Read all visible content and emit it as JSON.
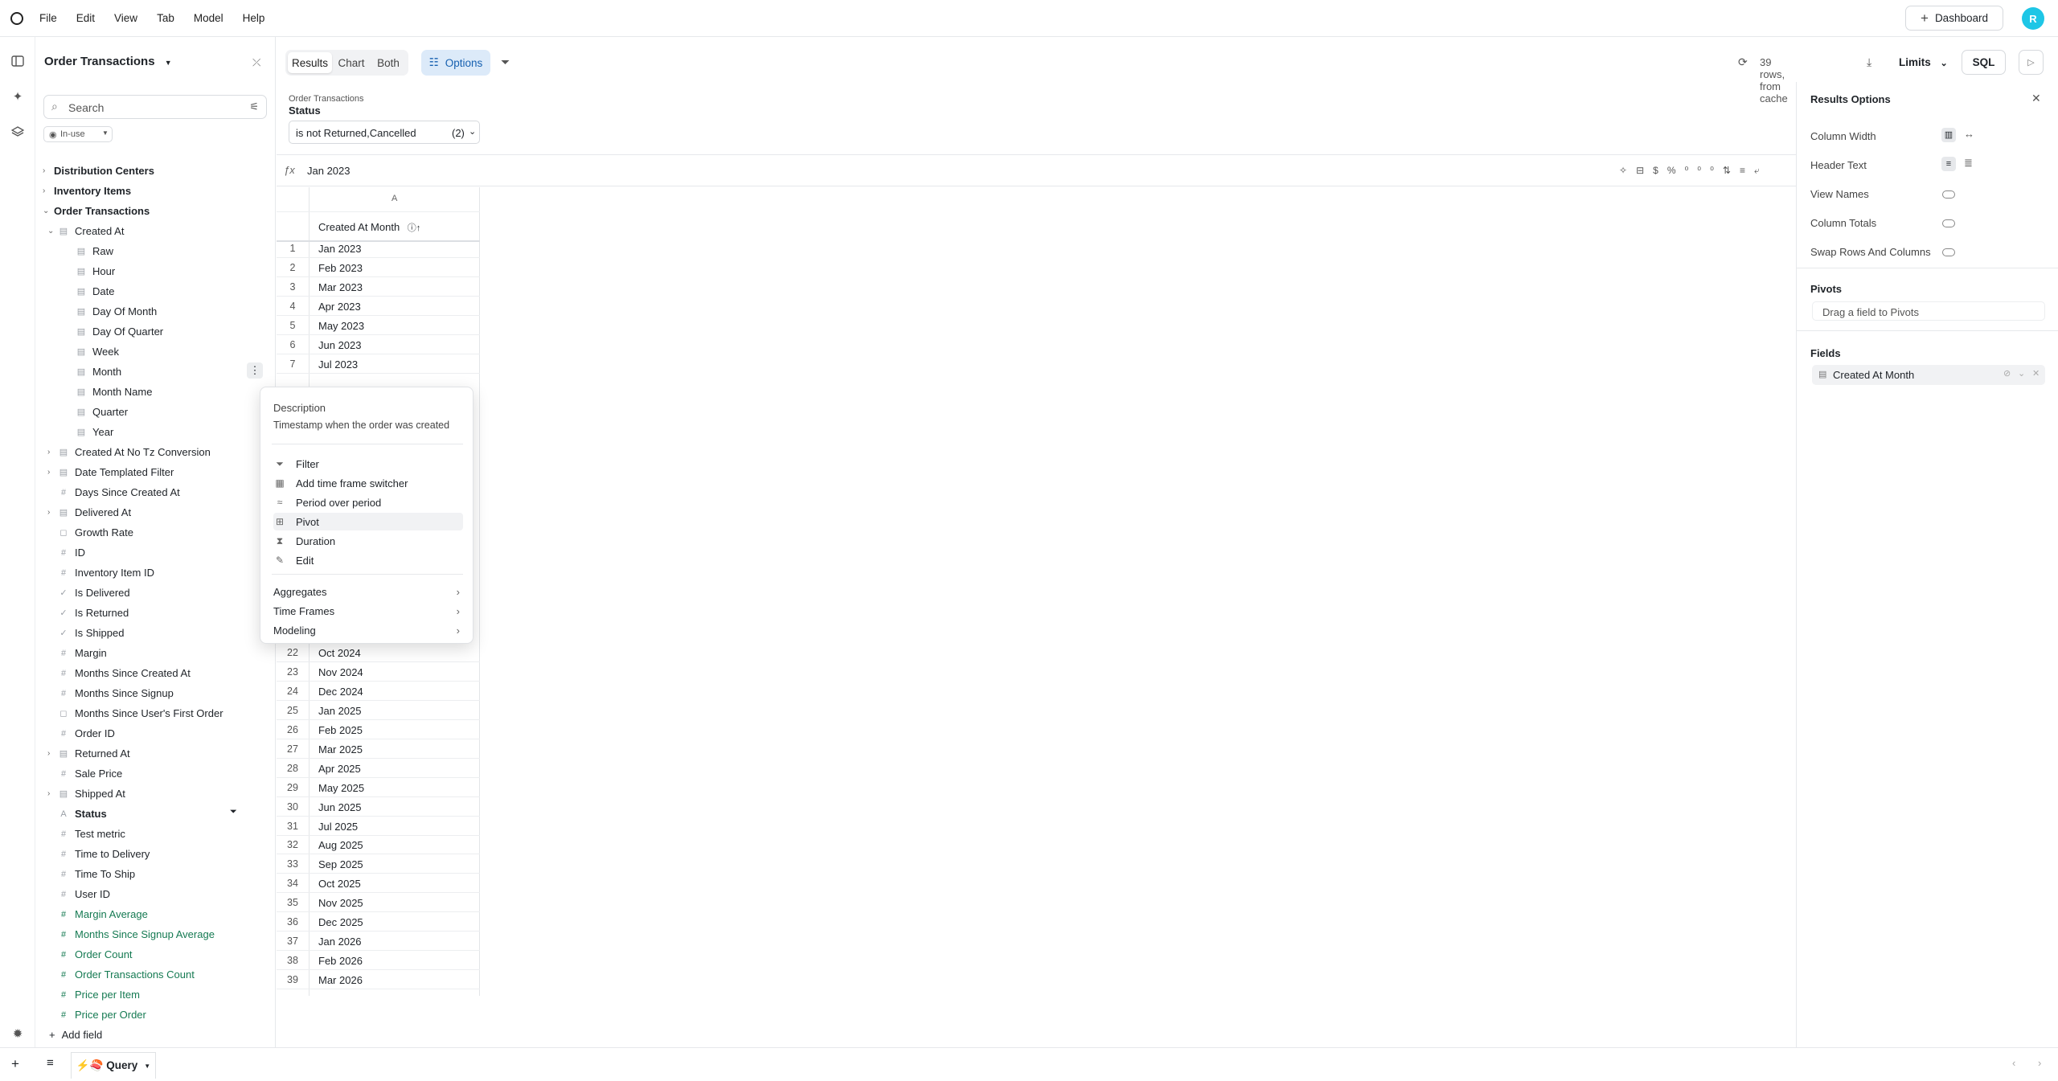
{
  "menubar": {
    "items": [
      "File",
      "Edit",
      "View",
      "Tab",
      "Model",
      "Help"
    ],
    "dashboard_label": "Dashboard",
    "avatar_letter": "R"
  },
  "sidebar": {
    "title": "Order Transactions",
    "search_placeholder": "Search",
    "inuse_label": "In-use",
    "add_field_label": "Add field",
    "rows": [
      {
        "label": "Distribution Centers",
        "level": 0,
        "chev": "›",
        "bold": true
      },
      {
        "label": "Inventory Items",
        "level": 0,
        "chev": "›",
        "bold": true
      },
      {
        "label": "Order Transactions",
        "level": 0,
        "chev": "⌄",
        "bold": true
      },
      {
        "label": "Created At",
        "level": 1,
        "chev": "⌄",
        "icon": "▤"
      },
      {
        "label": "Raw",
        "level": 2,
        "icon": "▤"
      },
      {
        "label": "Hour",
        "level": 2,
        "icon": "▤"
      },
      {
        "label": "Date",
        "level": 2,
        "icon": "▤"
      },
      {
        "label": "Day Of Month",
        "level": 2,
        "icon": "▤"
      },
      {
        "label": "Day Of Quarter",
        "level": 2,
        "icon": "▤"
      },
      {
        "label": "Week",
        "level": 2,
        "icon": "▤"
      },
      {
        "label": "Month",
        "level": 2,
        "icon": "▤",
        "menu": true
      },
      {
        "label": "Month Name",
        "level": 2,
        "icon": "▤"
      },
      {
        "label": "Quarter",
        "level": 2,
        "icon": "▤"
      },
      {
        "label": "Year",
        "level": 2,
        "icon": "▤"
      },
      {
        "label": "Created At No Tz Conversion",
        "level": 1,
        "chev": "›",
        "icon": "▤"
      },
      {
        "label": "Date Templated Filter",
        "level": 1,
        "chev": "›",
        "icon": "▤"
      },
      {
        "label": "Days Since Created At",
        "level": 1,
        "icon": "#"
      },
      {
        "label": "Delivered At",
        "level": 1,
        "chev": "›",
        "icon": "▤"
      },
      {
        "label": "Growth Rate",
        "level": 1,
        "icon": "◻"
      },
      {
        "label": "ID",
        "level": 1,
        "icon": "#"
      },
      {
        "label": "Inventory Item ID",
        "level": 1,
        "icon": "#"
      },
      {
        "label": "Is Delivered",
        "level": 1,
        "icon": "✓"
      },
      {
        "label": "Is Returned",
        "level": 1,
        "icon": "✓"
      },
      {
        "label": "Is Shipped",
        "level": 1,
        "icon": "✓"
      },
      {
        "label": "Margin",
        "level": 1,
        "icon": "#"
      },
      {
        "label": "Months Since Created At",
        "level": 1,
        "icon": "#"
      },
      {
        "label": "Months Since Signup",
        "level": 1,
        "icon": "#"
      },
      {
        "label": "Months Since User's First Order",
        "level": 1,
        "icon": "◻"
      },
      {
        "label": "Order ID",
        "level": 1,
        "icon": "#"
      },
      {
        "label": "Returned At",
        "level": 1,
        "chev": "›",
        "icon": "▤"
      },
      {
        "label": "Sale Price",
        "level": 1,
        "icon": "#"
      },
      {
        "label": "Shipped At",
        "level": 1,
        "chev": "›",
        "icon": "▤"
      },
      {
        "label": "Status",
        "level": 1,
        "icon": "A",
        "bold": true,
        "filter": true
      },
      {
        "label": "Test metric",
        "level": 1,
        "icon": "#"
      },
      {
        "label": "Time to Delivery",
        "level": 1,
        "icon": "#"
      },
      {
        "label": "Time To Ship",
        "level": 1,
        "icon": "#"
      },
      {
        "label": "User ID",
        "level": 1,
        "icon": "#"
      },
      {
        "label": "Margin Average",
        "level": 1,
        "icon": "#",
        "measure": true
      },
      {
        "label": "Months Since Signup Average",
        "level": 1,
        "icon": "#",
        "measure": true
      },
      {
        "label": "Order Count",
        "level": 1,
        "icon": "#",
        "measure": true
      },
      {
        "label": "Order Transactions Count",
        "level": 1,
        "icon": "#",
        "measure": true
      },
      {
        "label": "Price per Item",
        "level": 1,
        "icon": "#",
        "measure": true
      },
      {
        "label": "Price per Order",
        "level": 1,
        "icon": "#",
        "measure": true
      }
    ]
  },
  "toolbar": {
    "tabs": [
      "Results",
      "Chart",
      "Both"
    ],
    "options_label": "Options",
    "rows_info": "39 rows, from cache",
    "limits_label": "Limits",
    "sql_label": "SQL"
  },
  "filter": {
    "breadcrumb": "Order Transactions",
    "field": "Status",
    "value": "is not Returned,Cancelled",
    "count": "(2)"
  },
  "formula": {
    "value": "Jan  2023"
  },
  "grid": {
    "column_letter": "A",
    "header": "Created At Month",
    "rows": [
      [
        "1",
        "Jan 2023"
      ],
      [
        "2",
        "Feb 2023"
      ],
      [
        "3",
        "Mar 2023"
      ],
      [
        "4",
        "Apr 2023"
      ],
      [
        "5",
        "May 2023"
      ],
      [
        "6",
        "Jun 2023"
      ],
      [
        "7",
        "Jul 2023"
      ],
      [
        "22",
        "Oct 2024"
      ],
      [
        "23",
        "Nov 2024"
      ],
      [
        "24",
        "Dec 2024"
      ],
      [
        "25",
        "Jan 2025"
      ],
      [
        "26",
        "Feb 2025"
      ],
      [
        "27",
        "Mar 2025"
      ],
      [
        "28",
        "Apr 2025"
      ],
      [
        "29",
        "May 2025"
      ],
      [
        "30",
        "Jun 2025"
      ],
      [
        "31",
        "Jul 2025"
      ],
      [
        "32",
        "Aug 2025"
      ],
      [
        "33",
        "Sep 2025"
      ],
      [
        "34",
        "Oct 2025"
      ],
      [
        "35",
        "Nov 2025"
      ],
      [
        "36",
        "Dec 2025"
      ],
      [
        "37",
        "Jan 2026"
      ],
      [
        "38",
        "Feb 2026"
      ],
      [
        "39",
        "Mar 2026"
      ]
    ]
  },
  "popup": {
    "desc_title": "Description",
    "desc_text": "Timestamp when the order was created",
    "actions": [
      {
        "label": "Filter",
        "icon": "⏷"
      },
      {
        "label": "Add time frame switcher",
        "icon": "▦"
      },
      {
        "label": "Period over period",
        "icon": "≈"
      },
      {
        "label": "Pivot",
        "icon": "⊞"
      },
      {
        "label": "Duration",
        "icon": "⧗"
      },
      {
        "label": "Edit",
        "icon": "✎"
      }
    ],
    "submenus": [
      "Aggregates",
      "Time Frames",
      "Modeling"
    ]
  },
  "results_options": {
    "title": "Results Options",
    "settings": [
      "Column Width",
      "Header Text",
      "View Names",
      "Column Totals",
      "Swap Rows And Columns"
    ],
    "pivots_title": "Pivots",
    "pivots_placeholder": "Drag a field to Pivots",
    "fields_title": "Fields",
    "field_pill": "Created At Month"
  },
  "bottom": {
    "tab_label": "⚡🍣 Query"
  }
}
